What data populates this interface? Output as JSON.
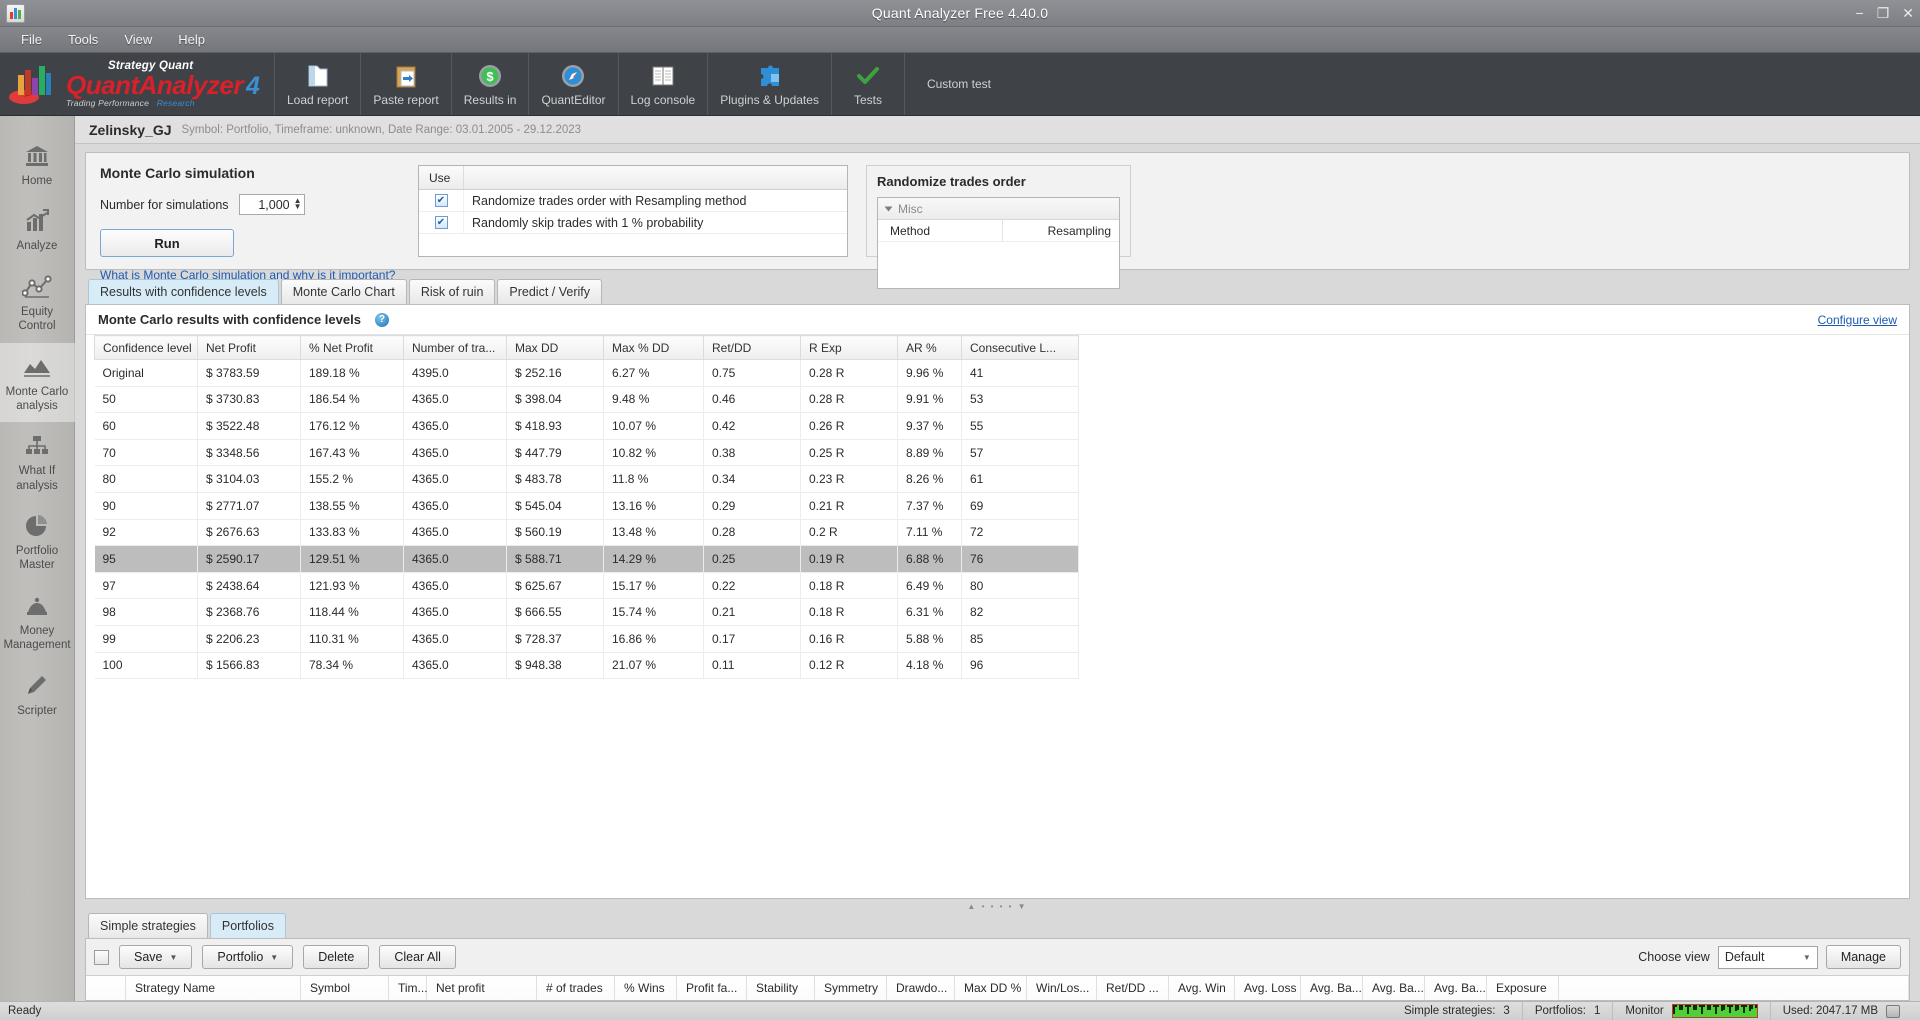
{
  "window": {
    "title": "Quant Analyzer Free 4.40.0",
    "minimize": "−",
    "maximize": "❐",
    "close": "✕"
  },
  "menu": [
    "File",
    "Tools",
    "View",
    "Help"
  ],
  "logo": {
    "line1": "Strategy Quant",
    "line2": "QuantAnalyzer",
    "version": "4",
    "line3a": "Trading Performance",
    "line3b": "Research"
  },
  "toolbar": [
    {
      "label": "Load report",
      "icon": "folder-icon"
    },
    {
      "label": "Paste report",
      "icon": "clipboard-icon"
    },
    {
      "label": "Results in",
      "icon": "dollar-icon"
    },
    {
      "label": "QuantEditor",
      "icon": "compass-icon"
    },
    {
      "label": "Log console",
      "icon": "book-icon"
    },
    {
      "label": "Plugins & Updates",
      "icon": "puzzle-icon"
    },
    {
      "label": "Tests",
      "icon": "check-icon"
    },
    {
      "label": "Custom test",
      "icon": ""
    }
  ],
  "sidebar": [
    {
      "label": "Home",
      "icon": "bank-icon",
      "active": false
    },
    {
      "label": "Analyze",
      "icon": "chart-up-icon",
      "active": false
    },
    {
      "label": "Equity\nControl",
      "icon": "line-nodes-icon",
      "active": false
    },
    {
      "label": "Monte Carlo\nanalysis",
      "icon": "mountain-chart-icon",
      "active": true
    },
    {
      "label": "What If\nanalysis",
      "icon": "hierarchy-icon",
      "active": false
    },
    {
      "label": "Portfolio\nMaster",
      "icon": "pie-chart-icon",
      "active": false
    },
    {
      "label": "Money\nManagement",
      "icon": "money-icon",
      "active": false
    },
    {
      "label": "Scripter",
      "icon": "pencil-icon",
      "active": false
    }
  ],
  "breadcrumb": {
    "name": "Zelinsky_GJ",
    "meta": "Symbol: Portfolio, Timeframe: unknown, Date Range: 03.01.2005 - 29.12.2023"
  },
  "monte_carlo": {
    "title": "Monte Carlo simulation",
    "sim_label": "Number for simulations",
    "sim_value": "1,000",
    "run_label": "Run",
    "help_link": "What is Monte Carlo simulation and why is it important?",
    "use_header": "Use",
    "options": [
      {
        "label": "Randomize trades order with Resampling method",
        "checked": true
      },
      {
        "label": "Randomly skip trades with 1 % probability",
        "checked": true
      }
    ]
  },
  "randomize_panel": {
    "title": "Randomize trades order",
    "group": "Misc",
    "rows": [
      {
        "key": "Method",
        "value": "Resampling"
      }
    ]
  },
  "tabs": [
    {
      "label": "Results with confidence levels",
      "active": true
    },
    {
      "label": "Monte Carlo Chart",
      "active": false
    },
    {
      "label": "Risk of ruin",
      "active": false
    },
    {
      "label": "Predict / Verify",
      "active": false
    }
  ],
  "results": {
    "heading": "Monte Carlo results with confidence levels",
    "help_glyph": "?",
    "configure_view": "Configure view",
    "columns": [
      "Confidence level",
      "Net Profit",
      "% Net Profit",
      "Number of tra...",
      "Max DD",
      "Max % DD",
      "Ret/DD",
      "R Exp",
      "AR %",
      "Consecutive L..."
    ],
    "rows": [
      {
        "selected": false,
        "cells": [
          "Original",
          "$ 3783.59",
          "189.18 %",
          "4395.0",
          "$ 252.16",
          "6.27 %",
          "0.75",
          "0.28 R",
          "9.96 %",
          "41"
        ]
      },
      {
        "selected": false,
        "cells": [
          "50",
          "$ 3730.83",
          "186.54 %",
          "4365.0",
          "$ 398.04",
          "9.48 %",
          "0.46",
          "0.28 R",
          "9.91 %",
          "53"
        ]
      },
      {
        "selected": false,
        "cells": [
          "60",
          "$ 3522.48",
          "176.12 %",
          "4365.0",
          "$ 418.93",
          "10.07 %",
          "0.42",
          "0.26 R",
          "9.37 %",
          "55"
        ]
      },
      {
        "selected": false,
        "cells": [
          "70",
          "$ 3348.56",
          "167.43 %",
          "4365.0",
          "$ 447.79",
          "10.82 %",
          "0.38",
          "0.25 R",
          "8.89 %",
          "57"
        ]
      },
      {
        "selected": false,
        "cells": [
          "80",
          "$ 3104.03",
          "155.2 %",
          "4365.0",
          "$ 483.78",
          "11.8 %",
          "0.34",
          "0.23 R",
          "8.26 %",
          "61"
        ]
      },
      {
        "selected": false,
        "cells": [
          "90",
          "$ 2771.07",
          "138.55 %",
          "4365.0",
          "$ 545.04",
          "13.16 %",
          "0.29",
          "0.21 R",
          "7.37 %",
          "69"
        ]
      },
      {
        "selected": false,
        "cells": [
          "92",
          "$ 2676.63",
          "133.83 %",
          "4365.0",
          "$ 560.19",
          "13.48 %",
          "0.28",
          "0.2 R",
          "7.11 %",
          "72"
        ]
      },
      {
        "selected": true,
        "cells": [
          "95",
          "$ 2590.17",
          "129.51 %",
          "4365.0",
          "$ 588.71",
          "14.29 %",
          "0.25",
          "0.19 R",
          "6.88 %",
          "76"
        ]
      },
      {
        "selected": false,
        "cells": [
          "97",
          "$ 2438.64",
          "121.93 %",
          "4365.0",
          "$ 625.67",
          "15.17 %",
          "0.22",
          "0.18 R",
          "6.49 %",
          "80"
        ]
      },
      {
        "selected": false,
        "cells": [
          "98",
          "$ 2368.76",
          "118.44 %",
          "4365.0",
          "$ 666.55",
          "15.74 %",
          "0.21",
          "0.18 R",
          "6.31 %",
          "82"
        ]
      },
      {
        "selected": false,
        "cells": [
          "99",
          "$ 2206.23",
          "110.31 %",
          "4365.0",
          "$ 728.37",
          "16.86 %",
          "0.17",
          "0.16 R",
          "5.88 %",
          "85"
        ]
      },
      {
        "selected": false,
        "cells": [
          "100",
          "$ 1566.83",
          "78.34 %",
          "4365.0",
          "$ 948.38",
          "21.07 %",
          "0.11",
          "0.12 R",
          "4.18 %",
          "96"
        ]
      }
    ]
  },
  "splitter_glyphs": "▲ • • • • ▼",
  "bottom": {
    "tabs": [
      {
        "label": "Simple strategies",
        "active": false
      },
      {
        "label": "Portfolios",
        "active": true
      }
    ],
    "buttons": [
      {
        "label": "Save",
        "caret": "▼"
      },
      {
        "label": "Portfolio",
        "caret": "▼"
      },
      {
        "label": "Delete",
        "caret": ""
      },
      {
        "label": "Clear All",
        "caret": ""
      }
    ],
    "choose_view_label": "Choose view",
    "view_value": "Default",
    "view_caret": "▼",
    "manage_label": "Manage",
    "columns": [
      "",
      "Strategy Name",
      "Symbol",
      "Tim...",
      "Net profit",
      "# of trades",
      "% Wins",
      "Profit fa...",
      "Stability",
      "Symmetry",
      "Drawdo...",
      "Max DD %",
      "Win/Los...",
      "Ret/DD ...",
      "Avg. Win",
      "Avg. Loss",
      "Avg. Ba...",
      "Avg. Ba...",
      "Avg. Ba...",
      "Exposure"
    ]
  },
  "status": {
    "ready": "Ready",
    "simple_strategies_label": "Simple strategies:",
    "simple_strategies_value": "3",
    "portfolios_label": "Portfolios:",
    "portfolios_value": "1",
    "monitor_label": "Monitor",
    "memory": "Used: 2047.17 MB"
  },
  "colors": {
    "accent_red": "#d8212b",
    "accent_blue": "#3b8fd4",
    "link": "#1e59b0",
    "toolbar_bg": "#3f4247",
    "selection": "#bdbdbd",
    "tab_active": "#d7ecf7"
  }
}
